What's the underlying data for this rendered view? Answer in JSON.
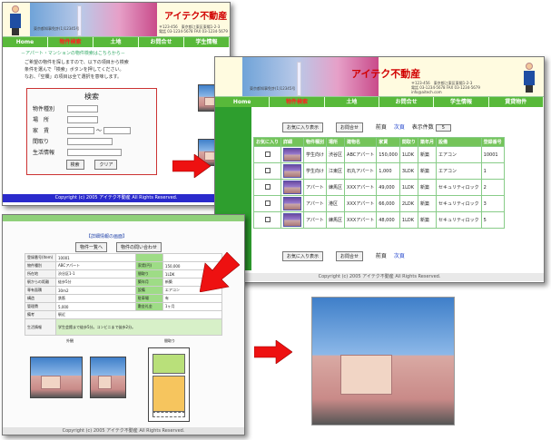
{
  "site": {
    "logo": "アイテク不動産",
    "address_line1": "〒123-456　東京都江東区東陽1-2-3",
    "address_line2": "電話 03-1234-5678  FAX 03-1234-5679",
    "company_note": "東京都知事免許(1)12345号",
    "company_note2": "(社)東京都宅地建物取引業協会会員",
    "email": "info@aitech.com"
  },
  "nav": [
    "Home",
    "物件検索",
    "土地",
    "お問合せ",
    "会社案内",
    "学生情報",
    "賃貸物件"
  ],
  "colors": {
    "accent_green": "#58b93a",
    "logo_red": "#d10000",
    "arrow_red": "#ee1111"
  },
  "window1": {
    "breadcrumb": "－アパート・マンションの物件検索はこちらから－",
    "intro_line1": "ご希望の物件を探しますので、以下の項目から検索",
    "intro_line2": "条件を選んで「検索」ボタンを押してください。",
    "intro_line3": "なお、「空欄」の項目は全て選択を意味します。",
    "search_title": "検索",
    "fields": [
      "物件種別",
      "場　所",
      "家　賃",
      "間取り",
      "生活情報"
    ],
    "search_button": "検索",
    "clear_button": "クリア",
    "copyright": "Copyright (c) 2005 アイテク不動産 All Rights Reserved."
  },
  "window2": {
    "show_favorites": "お気に入り表示",
    "inquire": "お問合せ",
    "prev": "前頁",
    "next": "次頁",
    "per_page_label": "表示件数",
    "per_page_value": "5",
    "columns": [
      "お気に入り",
      "詳細",
      "物件種別",
      "場所",
      "建物名",
      "家賃",
      "間取り",
      "築年月",
      "設備",
      "登録番号"
    ],
    "rows": [
      [
        "学生向け",
        "渋谷区",
        "ABCアパート",
        "150,000",
        "1LDK",
        "新築",
        "エアコン",
        "10001"
      ],
      [
        "学生向け",
        "江東区",
        "石丸アパート",
        "1,000",
        "3LDK",
        "新築",
        "エアコン",
        "1"
      ],
      [
        "アパート",
        "練馬区",
        "XXXアパート",
        "49,000",
        "1LDK",
        "新築",
        "セキュリティロック",
        "2"
      ],
      [
        "アパート",
        "港区",
        "XXXアパート",
        "66,000",
        "2LDK",
        "新築",
        "セキュリティロック",
        "3"
      ],
      [
        "アパート",
        "練馬区",
        "XXXアパート",
        "48,000",
        "1LDK",
        "新築",
        "セキュリティロック",
        "5"
      ]
    ],
    "copyright": "Copyright (c) 2005 アイテク不動産 All Rights Reserved."
  },
  "window3": {
    "title": "【詳細情報の画面】",
    "back_button": "物件一覧へ",
    "inquiry_button": "物件の問い合わせ",
    "details": [
      [
        "登録番号(Item)",
        "10001",
        "",
        ""
      ],
      [
        "物件種別",
        "ABCアパート",
        "家賃(円)",
        "150,000"
      ],
      [
        "所在地",
        "渋谷区1-1",
        "間取り",
        "1LDK"
      ],
      [
        "駅からの距離",
        "徒歩5分",
        "築年月",
        "新築"
      ],
      [
        "専有面積",
        "30m2",
        "設備",
        "エアコン"
      ],
      [
        "構造",
        "鉄筋",
        "駐車場",
        "有"
      ],
      [
        "管理費",
        "5,000",
        "敷金礼金",
        "1ヶ月"
      ]
    ],
    "note_label": "備考",
    "note_value": "駅近",
    "life_label": "生活情報",
    "life_value": "学生会館まで徒歩5分。コンビニまで徒歩2分。",
    "exterior_label": "外観",
    "floorplan_label": "間取り",
    "copyright": "Copyright (c) 2005 アイテク不動産 All Rights Reserved."
  }
}
